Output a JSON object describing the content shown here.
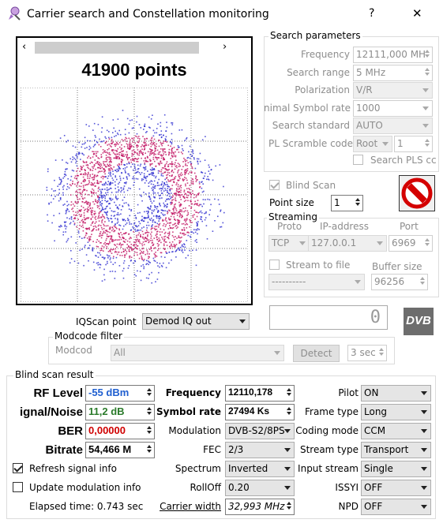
{
  "window": {
    "title": "Carrier search and Constellation monitoring",
    "help": "?",
    "close": "✕"
  },
  "constellation": {
    "points_label": "41900 points"
  },
  "search": {
    "group": "Search parameters",
    "frequency_label": "Frequency",
    "frequency_value": "12111,000 MH",
    "range_label": "Search range",
    "range_value": "5 MHz",
    "polarization_label": "Polarization",
    "polarization_value": "V/R",
    "symbol_rate_label": "nimal Symbol rate",
    "symbol_rate_value": "1000",
    "standard_label": "Search standard",
    "standard_value": "AUTO",
    "pl_label": "PL Scramble code",
    "pl_mode": "Root",
    "pl_value": "1",
    "pls_label": "Search PLS cc"
  },
  "blind": {
    "blind_scan_label": "Blind Scan",
    "point_size_label": "Point size",
    "point_size_value": "1"
  },
  "streaming": {
    "group": "Streaming",
    "proto_label": "Proto",
    "ip_label": "IP-address",
    "port_label": "Port",
    "proto_value": "TCP",
    "ip_value": "127.0.0.1",
    "port_value": "6969",
    "file_label": "Stream to file",
    "buffer_label": "Buffer size",
    "file_value": "----------",
    "buffer_value": "96256"
  },
  "counter": "0",
  "dvb_logo": "DVB",
  "iqscan": {
    "label": "IQScan point",
    "value": "Demod IQ out"
  },
  "modcode": {
    "group": "Modcode filter",
    "label": "Modcode",
    "value": "All",
    "detect": "Detect",
    "time": "3 sec"
  },
  "result": {
    "group": "Blind scan result",
    "rf_label": "RF Level",
    "rf_value": "-55 dBm",
    "snr_label": "ignal/Noise",
    "snr_value": "11,2 dB",
    "ber_label": "BER",
    "ber_value": "0,00000",
    "bitrate_label": "Bitrate",
    "bitrate_value": "54,466 M",
    "freq_label": "Frequency",
    "freq_value": "12110,178",
    "sr_label": "Symbol rate",
    "sr_value": "27494 Ks",
    "mod_label": "Modulation",
    "mod_value": "DVB-S2/8PS",
    "fec_label": "FEC",
    "fec_value": "2/3",
    "spectrum_label": "Spectrum",
    "spectrum_value": "Inverted",
    "rolloff_label": "RollOff",
    "rolloff_value": "0.20",
    "cw_label": "Carrier width",
    "cw_value": "32,993 MHz",
    "pilot_label": "Pilot",
    "pilot_value": "ON",
    "frame_label": "Frame type",
    "frame_value": "Long",
    "coding_label": "Coding mode",
    "coding_value": "CCM",
    "stype_label": "Stream type",
    "stype_value": "Transport",
    "istream_label": "Input stream",
    "istream_value": "Single",
    "issyi_label": "ISSYI",
    "issyi_value": "OFF",
    "npd_label": "NPD",
    "npd_value": "OFF",
    "refresh_label": "Refresh signal info",
    "update_label": "Update modulation info",
    "elapsed": "Elapsed time: 0.743 sec"
  },
  "colors": {
    "rf": "#1f5fd0",
    "snr": "#2a7a2a",
    "ber": "#d00000",
    "scatter_a": "#2b2bd0",
    "scatter_b": "#c01060"
  }
}
